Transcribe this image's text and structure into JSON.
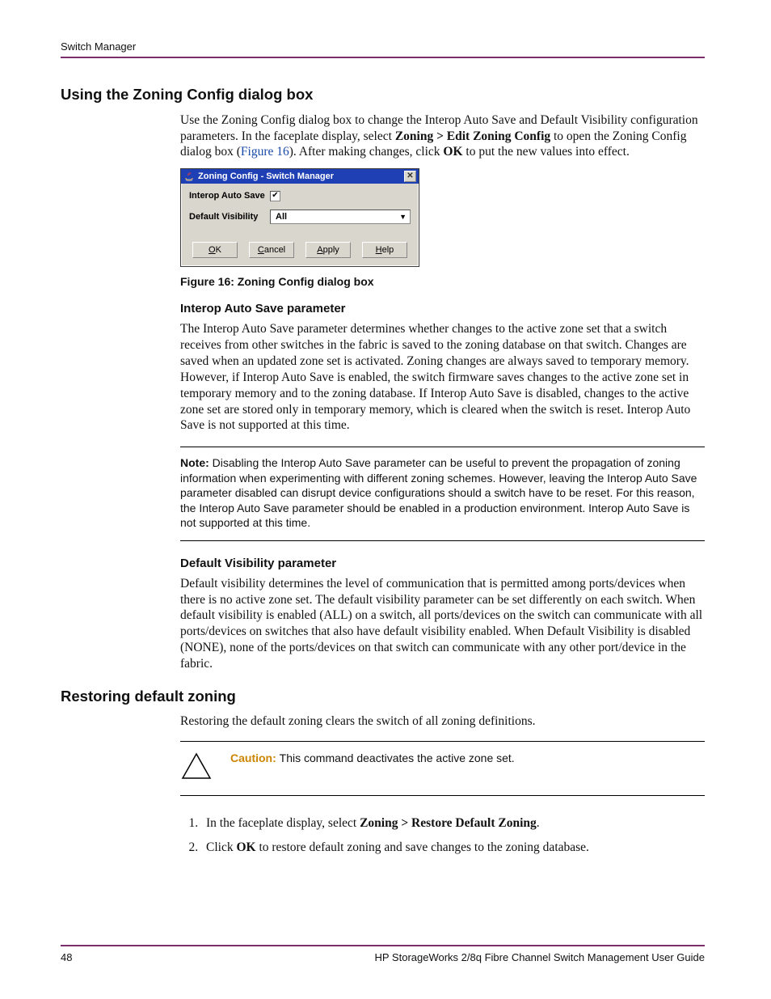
{
  "running_head": "Switch Manager",
  "sections": {
    "zoning_config": {
      "title": "Using the Zoning Config dialog box",
      "intro_pre": "Use the Zoning Config dialog box to change the Interop Auto Save and Default Visibility configuration parameters. In the faceplate display, select ",
      "intro_menu_bold": "Zoning > Edit Zoning Config",
      "intro_mid": " to open the Zoning Config dialog box (",
      "intro_figlink": "Figure 16",
      "intro_post": "). After making changes, click ",
      "intro_ok_bold": "OK",
      "intro_tail": " to put the new values into effect.",
      "figure_caption": "Figure 16:  Zoning Config dialog box",
      "interop": {
        "heading": "Interop Auto Save parameter",
        "body": "The Interop Auto Save parameter determines whether changes to the active zone set that a switch receives from other switches in the fabric is saved to the zoning database on that switch. Changes are saved when an updated zone set is activated. Zoning changes are always saved to temporary memory. However, if Interop Auto Save is enabled, the switch firmware saves changes to the active zone set in temporary memory and to the zoning database. If Interop Auto Save is disabled, changes to the active zone set are stored only in temporary memory, which is cleared when the switch is reset. Interop Auto Save is not supported at this time."
      },
      "note": {
        "label": "Note:  ",
        "body": "Disabling the Interop Auto Save parameter can be useful to prevent the propagation of zoning information when experimenting with different zoning schemes. However, leaving the Interop Auto Save parameter disabled can disrupt device configurations should a switch have to be reset. For this reason, the Interop Auto Save parameter should be enabled in a production environment. Interop Auto Save is not supported at this time."
      },
      "default_vis": {
        "heading": "Default Visibility parameter",
        "body": "Default visibility determines the level of communication that is permitted among ports/devices when there is no active zone set. The default visibility parameter can be set differently on each switch. When default visibility is enabled (ALL) on a switch, all ports/devices on the switch can communicate with all ports/devices on switches that also have default visibility enabled. When Default Visibility is disabled (NONE), none of the ports/devices on that switch can communicate with any other port/device in the fabric."
      }
    },
    "restore": {
      "title": "Restoring default zoning",
      "intro": "Restoring the default zoning clears the switch of all zoning definitions.",
      "caution": {
        "label": "Caution:  ",
        "body": "This command deactivates the active zone set."
      },
      "steps": {
        "s1_pre": "In the faceplate display, select ",
        "s1_bold": "Zoning > Restore Default Zoning",
        "s1_post": ".",
        "s2_pre": "Click ",
        "s2_bold": "OK",
        "s2_post": " to restore default zoning and save changes to the zoning database."
      }
    }
  },
  "dialog": {
    "title": "Zoning Config - Switch Manager",
    "close_glyph": "✕",
    "row1_label": "Interop Auto Save",
    "row1_check_glyph": "✔",
    "row2_label": "Default Visibility",
    "row2_value": "All",
    "dd_arrow": "▼",
    "buttons": {
      "ok_u": "O",
      "ok_r": "K",
      "cancel_u": "C",
      "cancel_r": "ancel",
      "apply_u": "A",
      "apply_r": "pply",
      "help_u": "H",
      "help_r": "elp"
    }
  },
  "footer": {
    "page": "48",
    "doc": "HP StorageWorks 2/8q Fibre Channel Switch Management User Guide"
  }
}
